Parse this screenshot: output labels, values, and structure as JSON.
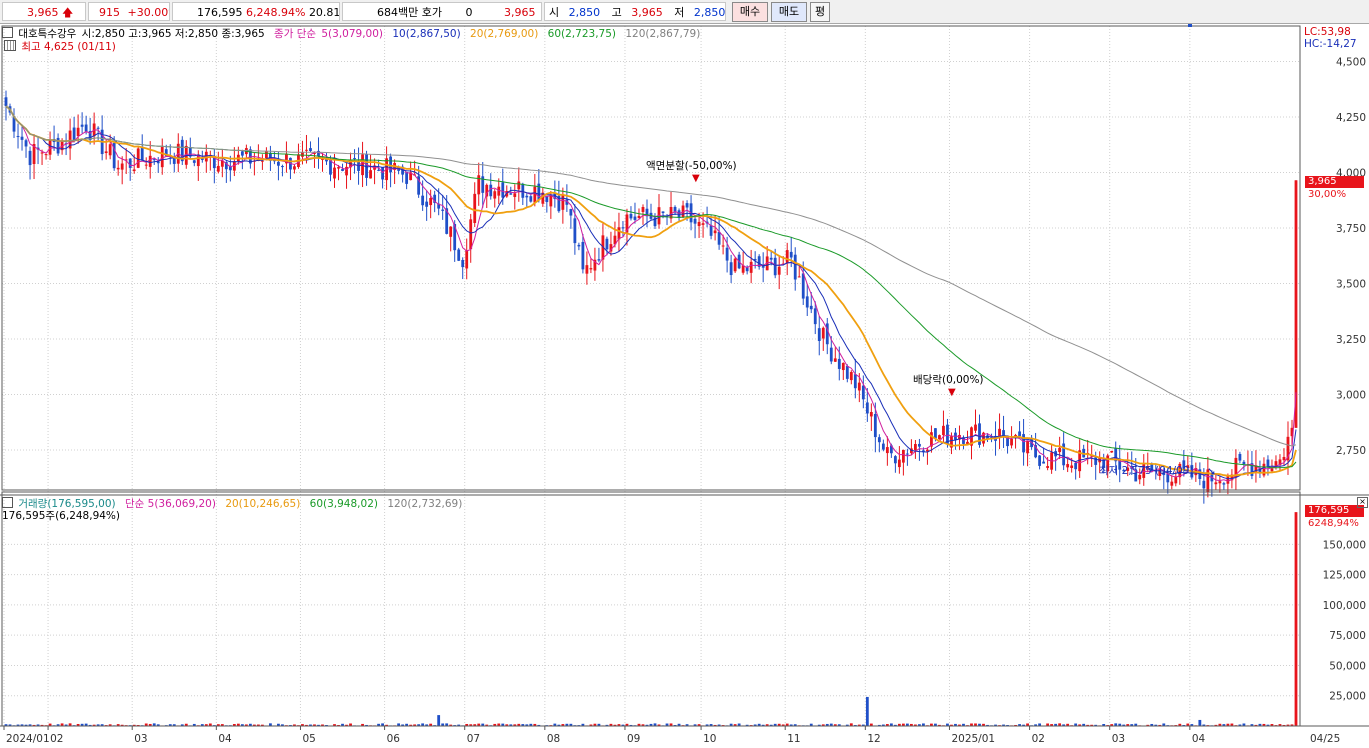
{
  "toolbar": {
    "price": "3,965",
    "change": "915",
    "change_pct": "+30.00%",
    "volume": "176,595",
    "volume_pct": "6,248.94%",
    "turnover_pct": "20.81%",
    "amount": "684백만",
    "quote_label": "호가",
    "quote_value": "0",
    "quote_price": "3,965",
    "open_label": "시",
    "open_value": "2,850",
    "high_label": "고",
    "high_value": "3,965",
    "low_label": "저",
    "low_value": "2,850",
    "buy_label": "매수",
    "sell_label": "매도",
    "eval_label": "평"
  },
  "colors": {
    "up": "#e8141b",
    "down": "#1f4fc8",
    "ma5": "#d0209f",
    "ma10": "#1a2fb8",
    "ma20": "#f0a010",
    "ma60": "#1a9a28",
    "ma120": "#909090"
  },
  "price_legend": {
    "stock": "대호특수강우",
    "ohlc": "시:2,850 고:3,965 저:2,850 종:3,965",
    "close_label": "종가 단순",
    "ma5": "5(3,079,00)",
    "ma10": "10(2,867,50)",
    "ma20": "20(2,769,00)",
    "ma60": "60(2,723,75)",
    "ma120": "120(2,867,79)",
    "high_note": "최고 4,625 (01/11)"
  },
  "volume_legend": {
    "vol": "거래량(176,595,00)",
    "ma5": "단순 5(36,069,20)",
    "ma20": "20(10,246,65)",
    "ma60": "60(3,948,02)",
    "ma120": "120(2,732,69)",
    "current": "176,595주(6,248,94%)"
  },
  "annotations": {
    "split": "액면분할(-50,00%)",
    "dividend": "배당락(0,00%)",
    "low_note": "최저 2,575 (04/09)"
  },
  "right_info": {
    "lc": "LC:53,98",
    "hc": "HC:-14,27"
  },
  "price_marker": {
    "value": "3,965",
    "pct": "30,00%"
  },
  "volume_marker": {
    "value": "176,595",
    "pct": "6248,94%"
  },
  "chart_data": {
    "type": "candlestick",
    "price_axis": {
      "ticks": [
        "2,750",
        "3,000",
        "3,250",
        "3,500",
        "3,750",
        "4,000",
        "4,250",
        "4,500"
      ],
      "tick_values": [
        2750,
        3000,
        3250,
        3500,
        3750,
        4000,
        4250,
        4500
      ],
      "ylim": [
        2570,
        4660
      ]
    },
    "volume_axis": {
      "ticks": [
        "25,000",
        "50,000",
        "75,000",
        "100,000",
        "125,000",
        "150,000"
      ],
      "tick_values": [
        25000,
        50000,
        75000,
        100000,
        125000,
        150000
      ],
      "ylim": [
        0,
        180000
      ]
    },
    "x_ticks": [
      "2024/01",
      "02",
      "03",
      "04",
      "05",
      "06",
      "07",
      "08",
      "09",
      "10",
      "11",
      "12",
      "2025/01",
      "02",
      "03",
      "04",
      "04/25"
    ],
    "x_tick_index": [
      0,
      11,
      32,
      53,
      74,
      95,
      115,
      135,
      155,
      174,
      195,
      215,
      236,
      256,
      276,
      296,
      322
    ],
    "n_days": 323,
    "anchors": [
      [
        0,
        4300
      ],
      [
        6,
        4080
      ],
      [
        12,
        4120
      ],
      [
        20,
        4220
      ],
      [
        28,
        4030
      ],
      [
        40,
        4090
      ],
      [
        52,
        4060
      ],
      [
        64,
        4060
      ],
      [
        76,
        4050
      ],
      [
        90,
        4030
      ],
      [
        100,
        3990
      ],
      [
        108,
        3820
      ],
      [
        114,
        3620
      ],
      [
        118,
        3950
      ],
      [
        126,
        3930
      ],
      [
        134,
        3920
      ],
      [
        140,
        3860
      ],
      [
        144,
        3540
      ],
      [
        148,
        3650
      ],
      [
        154,
        3800
      ],
      [
        170,
        3800
      ],
      [
        176,
        3710
      ],
      [
        182,
        3560
      ],
      [
        190,
        3580
      ],
      [
        196,
        3600
      ],
      [
        204,
        3250
      ],
      [
        212,
        3050
      ],
      [
        220,
        2720
      ],
      [
        230,
        2800
      ],
      [
        238,
        2830
      ],
      [
        248,
        2820
      ],
      [
        256,
        2730
      ],
      [
        266,
        2700
      ],
      [
        274,
        2710
      ],
      [
        282,
        2650
      ],
      [
        290,
        2650
      ],
      [
        300,
        2620
      ],
      [
        310,
        2680
      ],
      [
        318,
        2700
      ],
      [
        321,
        2850
      ],
      [
        322,
        3965
      ]
    ],
    "volume_spikes": [
      [
        108,
        9000
      ],
      [
        215,
        24000
      ],
      [
        298,
        5000
      ],
      [
        322,
        176595
      ]
    ]
  }
}
